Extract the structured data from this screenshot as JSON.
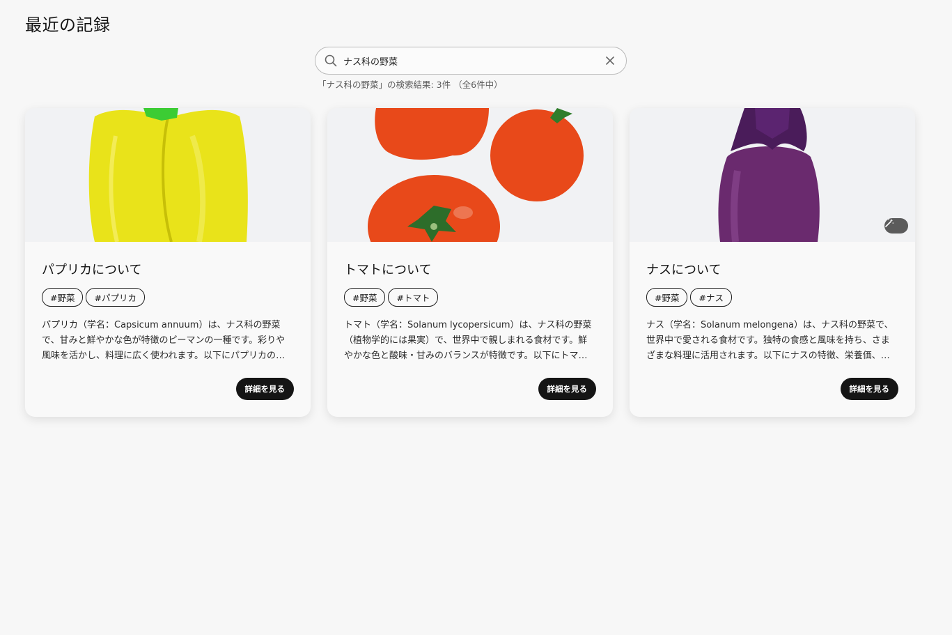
{
  "page": {
    "title": "最近の記録"
  },
  "search": {
    "value": "ナス科の野菜",
    "result_text": "「ナス科の野菜」の検索結果: 3件 （全6件中）"
  },
  "cards": [
    {
      "title": "パプリカについて",
      "image_icon": "yellow-paprika-image",
      "tags": [
        "#野菜",
        "#パプリカ"
      ],
      "description": "パプリカ（学名：Capsicum annuum）は、ナス科の野菜で、甘みと鮮やかな色が特徴のピーマンの一種です。彩りや風味を活かし、料理に広く使われます。以下にパプリカの特徴、栄養価、使い方を紹介します。",
      "button": "詳細を見る"
    },
    {
      "title": "トマトについて",
      "image_icon": "tomatoes-image",
      "tags": [
        "#野菜",
        "#トマト"
      ],
      "description": "トマト（学名：Solanum lycopersicum）は、ナス科の野菜（植物学的には果実）で、世界中で親しまれる食材です。鮮やかな色と酸味・甘みのバランスが特徴です。以下にトマトの特徴、栄養価、使い方を紹介します。",
      "button": "詳細を見る"
    },
    {
      "title": "ナスについて",
      "image_icon": "eggplant-image",
      "tags": [
        "#野菜",
        "#ナス"
      ],
      "description": "ナス（学名：Solanum melongena）は、ナス科の野菜で、世界中で愛される食材です。独特の食感と風味を持ち、さまざまな料理に活用されます。以下にナスの特徴、栄養価、使い方を紹介します。",
      "button": "詳細を見る"
    }
  ],
  "colors": {
    "button_bg": "#151515",
    "paprika": "#e6e010",
    "tomato": "#e8491a",
    "eggplant": "#6a2a6e"
  }
}
